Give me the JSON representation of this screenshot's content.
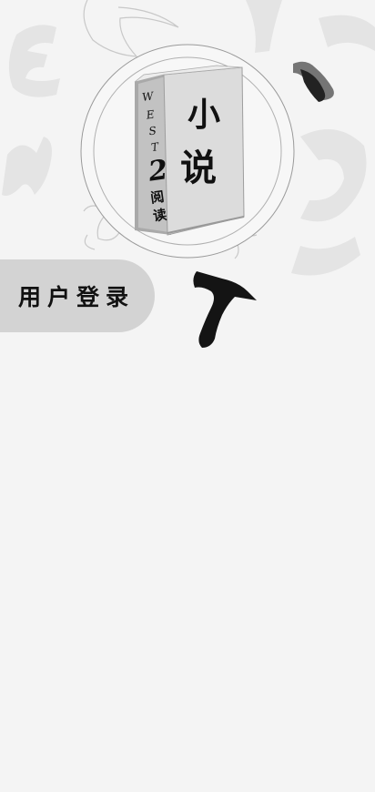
{
  "logo": {
    "spine_letters": [
      "W",
      "E",
      "S",
      "T"
    ],
    "spine_number": "2",
    "spine_chars": [
      "阅",
      "读"
    ],
    "cover_chars": [
      "小",
      "说"
    ]
  },
  "login_tab": {
    "label": "用户登录"
  },
  "colors": {
    "background": "#f4f4f4",
    "tab": "#d3d3d3",
    "ink": "#111111",
    "book": "#dadada"
  }
}
